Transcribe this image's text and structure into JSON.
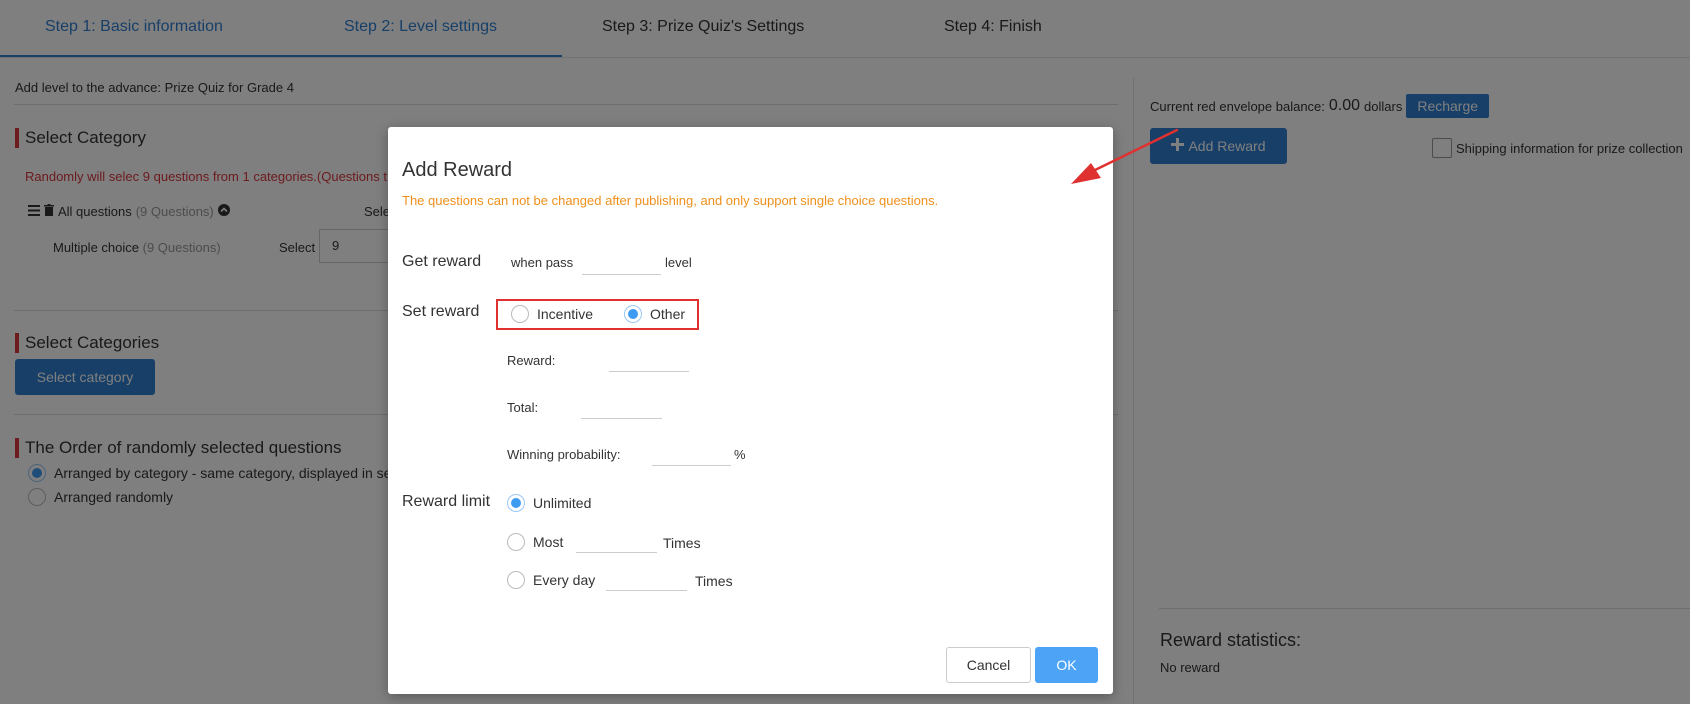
{
  "steps": [
    {
      "label": "Step 1: Basic information"
    },
    {
      "label": "Step 2: Level settings"
    },
    {
      "label": "Step 3:  Prize Quiz's Settings"
    },
    {
      "label": "Step 4: Finish"
    }
  ],
  "left": {
    "subtitle": "Add level to the advance: Prize Quiz for Grade 4",
    "select_category_title": "Select Category",
    "warning": "Randomly will selec 9 questions from 1 categories.(Questions t",
    "all_questions_label": "All questions",
    "all_questions_count": "(9 Questions)",
    "select_partial": "Sele",
    "multiple_choice_label": "Multiple choice",
    "multiple_choice_count": "(9 Questions)",
    "select_label": "Select",
    "select_value": "9",
    "select_categories_title": "Select Categories",
    "select_category_button": "Select category",
    "order_title": "The Order of randomly selected questions",
    "order_options": [
      {
        "label": "Arranged by category - same category, displayed in se",
        "selected": true
      },
      {
        "label": "Arranged randomly",
        "selected": false
      }
    ]
  },
  "right": {
    "balance_label": "Current red envelope balance:",
    "balance_amount": "0.00",
    "balance_unit": "dollars",
    "recharge_button": "Recharge",
    "add_reward_button": "Add Reward",
    "shipping_label": "Shipping information for prize collection",
    "stats_title": "Reward statistics:",
    "stats_empty": "No reward"
  },
  "modal": {
    "title": "Add Reward",
    "note": "The questions can not be changed after publishing, and only support single choice questions.",
    "get_reward_label": "Get reward",
    "when_pass": "when pass",
    "level": "level",
    "set_reward_label": "Set reward",
    "reward_types": [
      {
        "label": "Incentive",
        "selected": false
      },
      {
        "label": "Other",
        "selected": true
      }
    ],
    "reward_field": "Reward:",
    "total_field": "Total:",
    "probability_field": "Winning probability:",
    "percent": "%",
    "reward_limit_label": "Reward limit",
    "limit_options": [
      {
        "label": "Unlimited",
        "selected": true,
        "suffix": ""
      },
      {
        "label": "Most",
        "selected": false,
        "suffix": "Times"
      },
      {
        "label": "Every day",
        "selected": false,
        "suffix": "Times"
      }
    ],
    "cancel_button": "Cancel",
    "ok_button": "OK"
  },
  "colors": {
    "accent": "#2f7fd1",
    "warning_red": "#d9363e",
    "note_orange": "#f0901c",
    "highlight": "#e03131",
    "ok_blue": "#4da3f6"
  },
  "icons": [
    "list-icon",
    "trash-icon",
    "chevron-up-circle-icon",
    "plus-icon",
    "red-arrow-annotation"
  ]
}
